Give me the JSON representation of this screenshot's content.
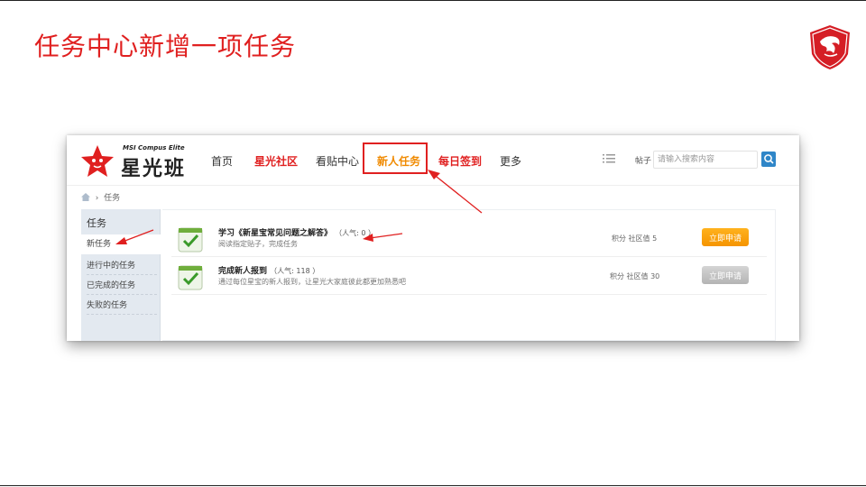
{
  "slide": {
    "title": "任务中心新增一项任务"
  },
  "site": {
    "logo_sub": "MSI Compus Elite",
    "logo_main": "星光班",
    "nav": [
      {
        "label": "首页",
        "style": "normal"
      },
      {
        "label": "星光社区",
        "style": "red"
      },
      {
        "label": "看贴中心",
        "style": "normal"
      },
      {
        "label": "新人任务",
        "style": "orange"
      },
      {
        "label": "每日签到",
        "style": "red"
      },
      {
        "label": "更多",
        "style": "normal"
      }
    ],
    "search": {
      "label": "帖子",
      "placeholder": "请输入搜索内容"
    }
  },
  "breadcrumb": {
    "current": "任务"
  },
  "sidebar": {
    "title": "任务",
    "items": [
      {
        "label": "新任务",
        "active": true
      },
      {
        "label": "进行中的任务",
        "active": false
      },
      {
        "label": "已完成的任务",
        "active": false
      },
      {
        "label": "失败的任务",
        "active": false
      }
    ]
  },
  "tasks": [
    {
      "title": "学习《新星宝常见问题之解答》",
      "popularity": "（人气: 0 ）",
      "desc": "阅读指定贴子，完成任务",
      "points": "积分 社区值 5",
      "button": "立即申请",
      "enabled": true
    },
    {
      "title": "完成新人报到",
      "popularity": "（人气: 118 ）",
      "desc": "通过每位星宝的新人报到，让星光大家庭彼此都更加熟悉吧",
      "points": "积分 社区值 30",
      "button": "立即申请",
      "enabled": false
    }
  ],
  "colors": {
    "accent_red": "#e02020",
    "nav_orange": "#f08a00",
    "button_orange": "#f59400",
    "button_disabled": "#bdbdbd",
    "search_blue": "#2f86c8",
    "sidebar_bg": "#e3e9f0"
  },
  "icons": [
    "msi-dragon-shield-icon",
    "star-mascot-icon",
    "list-icon",
    "search-icon",
    "home-icon",
    "task-check-icon"
  ]
}
